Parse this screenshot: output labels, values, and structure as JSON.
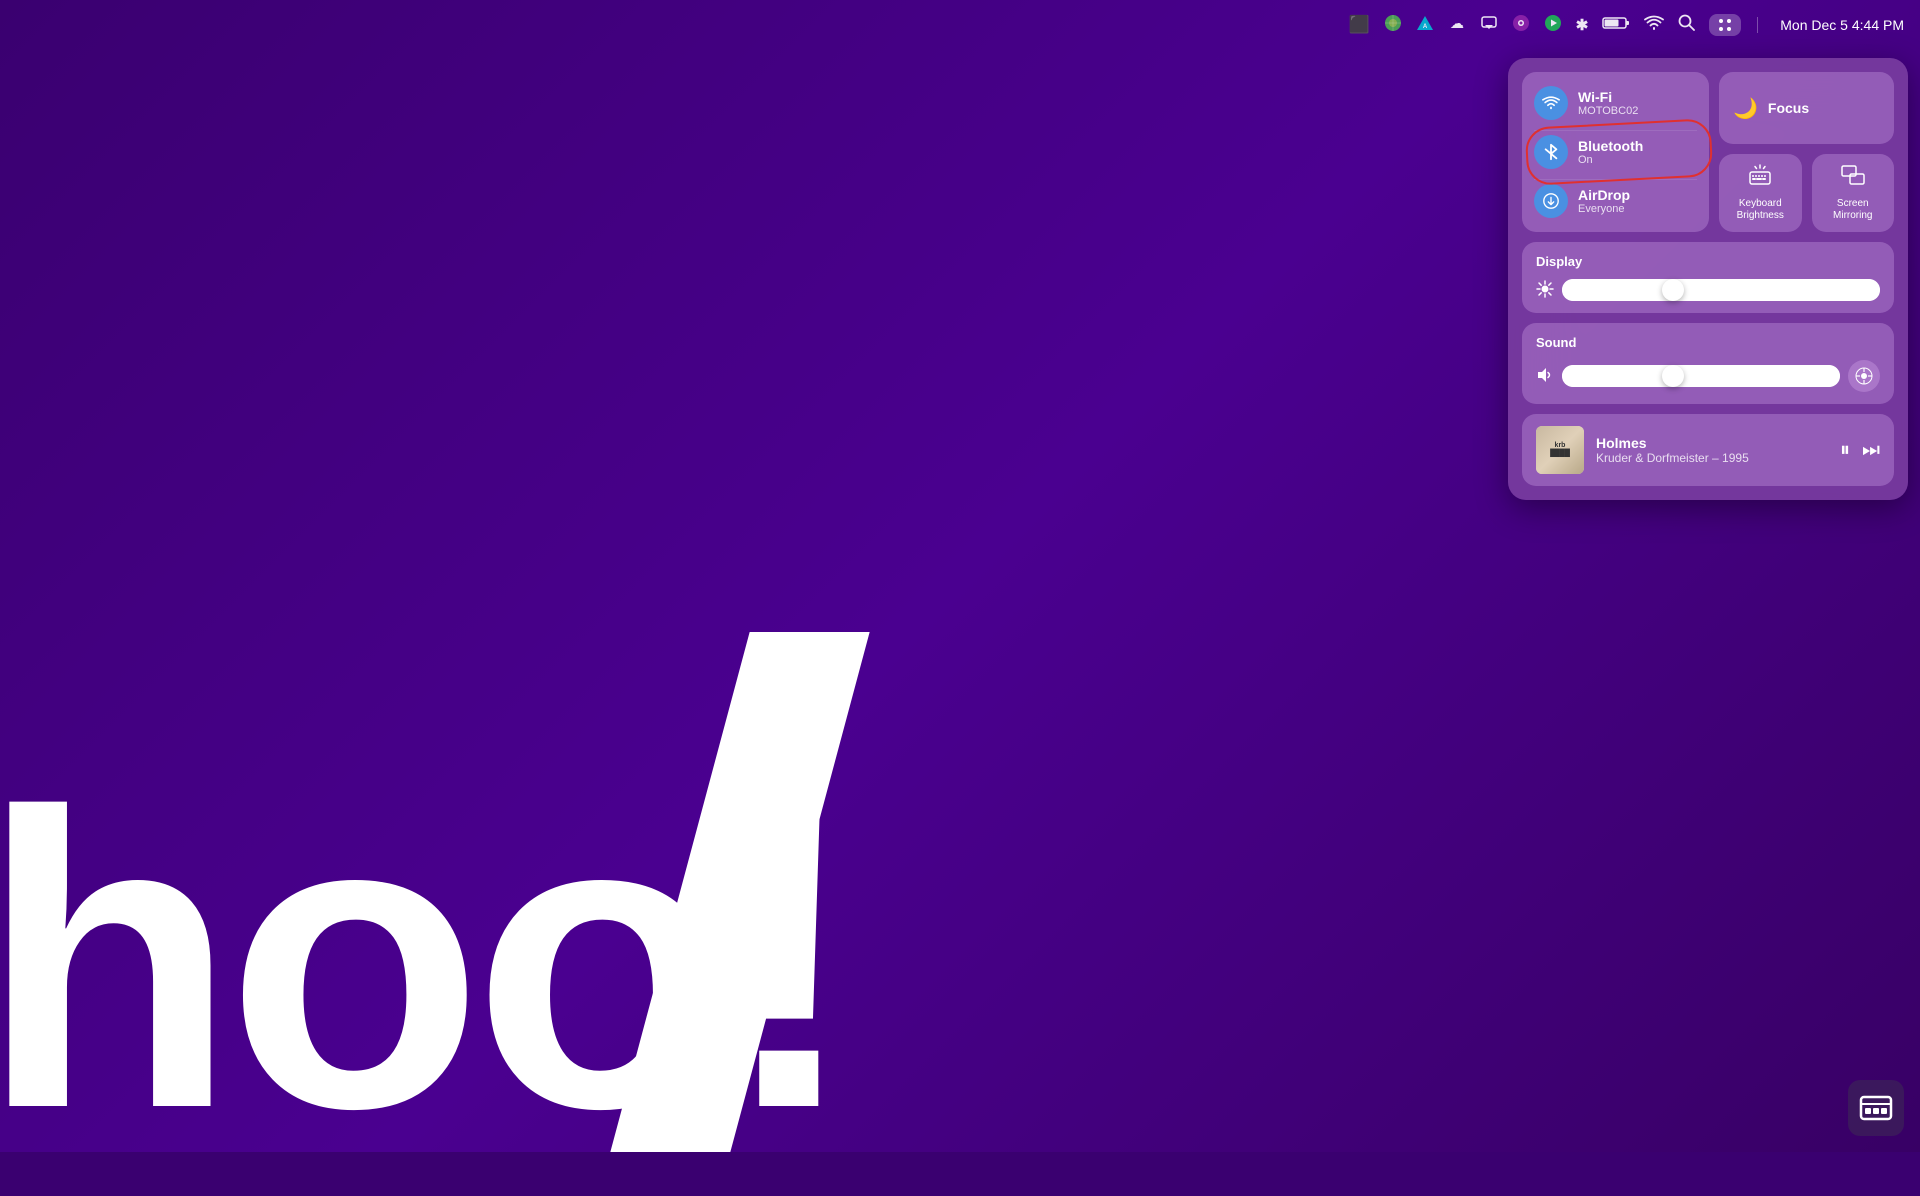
{
  "desktop": {
    "bg_color": "#3a0070",
    "text": "hoo!"
  },
  "menubar": {
    "time": "Mon Dec 5  4:44 PM",
    "icons": [
      {
        "name": "projector-icon",
        "symbol": "⬛"
      },
      {
        "name": "maps-icon",
        "symbol": "🌍"
      },
      {
        "name": "arq-icon",
        "symbol": "△"
      },
      {
        "name": "creative-cloud-icon",
        "symbol": "☁"
      },
      {
        "name": "airplay-icon",
        "symbol": "▭"
      },
      {
        "name": "podcast-icon",
        "symbol": "⏺"
      },
      {
        "name": "music-icon",
        "symbol": "▶"
      },
      {
        "name": "bluetooth-menubar-icon",
        "symbol": "✱"
      },
      {
        "name": "battery-icon",
        "symbol": "🔋"
      },
      {
        "name": "wifi-menubar-icon",
        "symbol": "WiFi"
      },
      {
        "name": "search-icon",
        "symbol": "🔍"
      },
      {
        "name": "control-center-icon",
        "symbol": "≡"
      }
    ]
  },
  "control_center": {
    "connectivity": {
      "wifi": {
        "label": "Wi-Fi",
        "subtitle": "MOTOBC02"
      },
      "bluetooth": {
        "label": "Bluetooth",
        "subtitle": "On",
        "highlighted": true
      },
      "airdrop": {
        "label": "AirDrop",
        "subtitle": "Everyone"
      }
    },
    "focus": {
      "label": "Focus"
    },
    "keyboard_brightness": {
      "label": "Keyboard Brightness"
    },
    "screen_mirroring": {
      "label": "Screen Mirroring"
    },
    "display": {
      "label": "Display",
      "value": 35
    },
    "sound": {
      "label": "Sound",
      "value": 40
    },
    "now_playing": {
      "title": "Holmes",
      "artist": "Kruder & Dorfmeister – 1995",
      "album_short": "krb"
    }
  },
  "corner": {
    "icon": "⊟"
  }
}
